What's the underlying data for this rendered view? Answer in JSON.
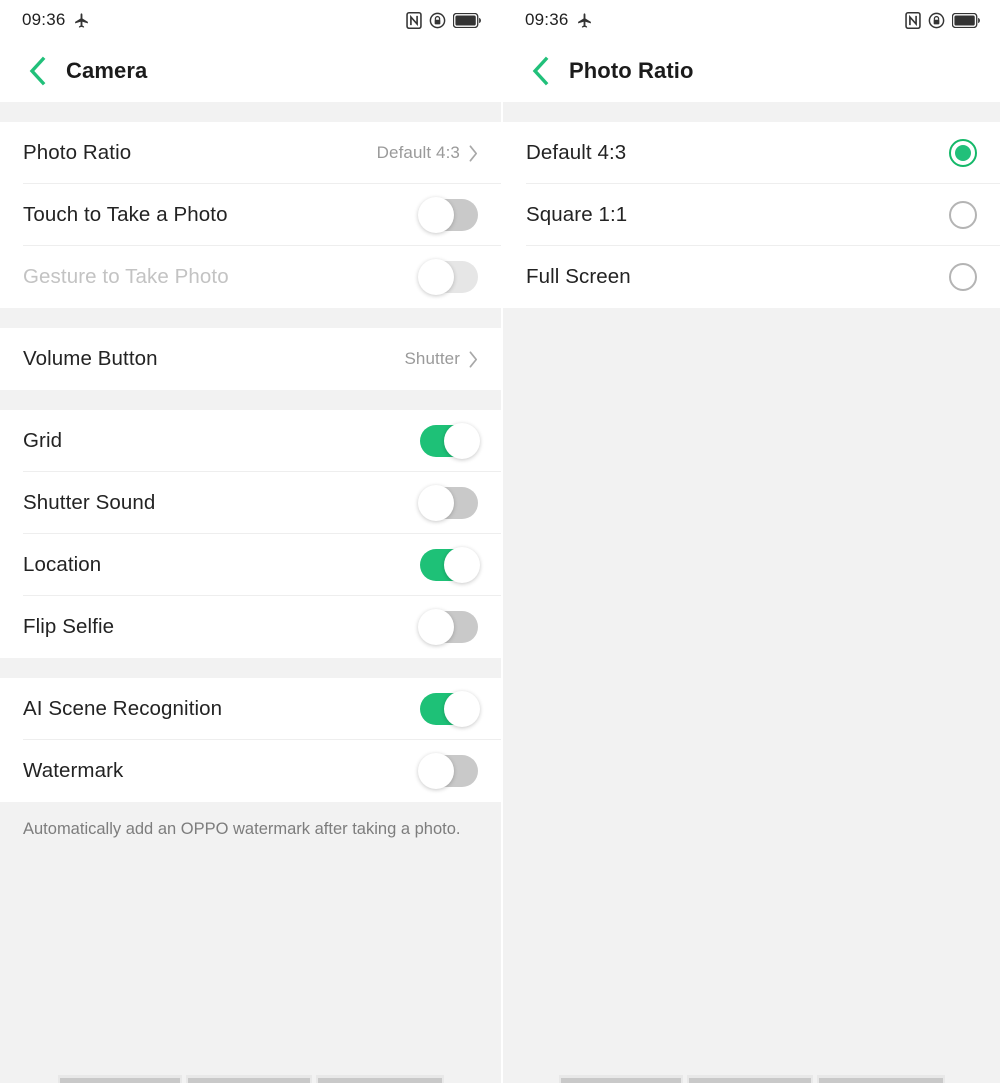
{
  "statusbar": {
    "time": "09:36",
    "icons": [
      "airplane-icon",
      "nfc-icon",
      "screen-lock-rotation-icon",
      "battery-icon"
    ]
  },
  "accent": {
    "green": "#21c07a",
    "toggle_on": "#1ec177",
    "toggle_off": "#c9c9c9",
    "toggle_off_disabled": "#e6e6e6",
    "radio_ring": "#14b869",
    "page_bg": "#f2f2f2",
    "card_bg": "#ffffff"
  },
  "left_screen": {
    "header": {
      "title": "Camera",
      "back_label": "Back"
    },
    "sections": [
      {
        "rows": [
          {
            "label": "Photo Ratio",
            "type": "value",
            "value": "Default 4:3",
            "disabled": false
          },
          {
            "label": "Touch to Take a Photo",
            "type": "toggle",
            "state": "off",
            "disabled": false
          },
          {
            "label": "Gesture to Take Photo",
            "type": "toggle",
            "state": "off",
            "disabled": true
          }
        ]
      },
      {
        "rows": [
          {
            "label": "Volume Button",
            "type": "value",
            "value": "Shutter",
            "disabled": false
          }
        ]
      },
      {
        "rows": [
          {
            "label": "Grid",
            "type": "toggle",
            "state": "on",
            "disabled": false
          },
          {
            "label": "Shutter Sound",
            "type": "toggle",
            "state": "off",
            "disabled": false
          },
          {
            "label": "Location",
            "type": "toggle",
            "state": "on",
            "disabled": false
          },
          {
            "label": "Flip Selfie",
            "type": "toggle",
            "state": "off",
            "disabled": false
          }
        ]
      },
      {
        "rows": [
          {
            "label": "AI Scene Recognition",
            "type": "toggle",
            "state": "on",
            "disabled": false
          },
          {
            "label": "Watermark",
            "type": "toggle",
            "state": "off",
            "disabled": false
          }
        ],
        "footnote": "Automatically add an OPPO watermark after taking a photo."
      }
    ]
  },
  "right_screen": {
    "header": {
      "title": "Photo Ratio",
      "back_label": "Back"
    },
    "options": [
      {
        "label": "Default 4:3",
        "selected": true
      },
      {
        "label": "Square 1:1",
        "selected": false
      },
      {
        "label": "Full Screen",
        "selected": false
      }
    ]
  }
}
